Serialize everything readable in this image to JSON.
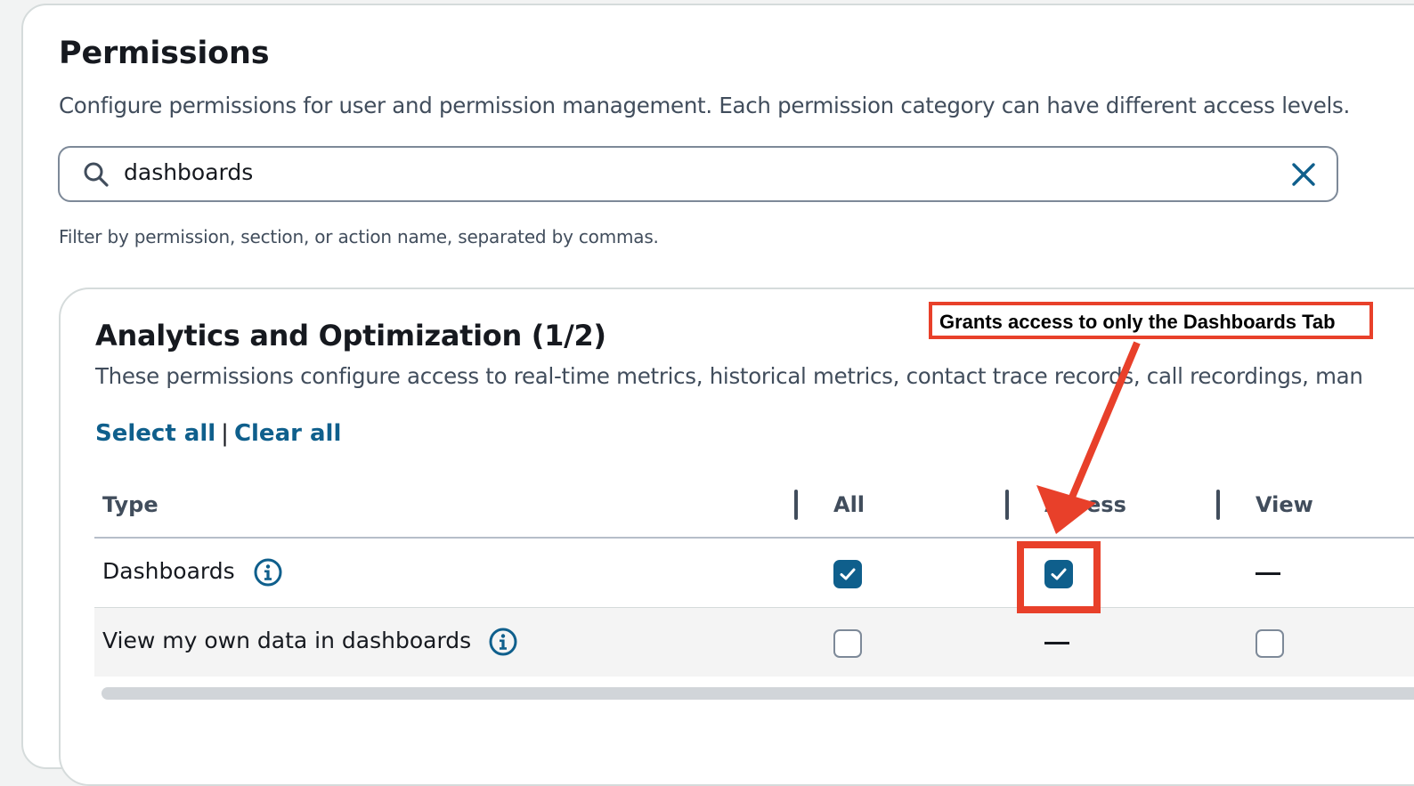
{
  "page": {
    "title": "Permissions",
    "description": "Configure permissions for user and permission management. Each permission category can have different access levels."
  },
  "search": {
    "value": "dashboards",
    "icon": "search-icon",
    "clear_icon": "close-icon",
    "hint": "Filter by permission, section, or action name, separated by commas."
  },
  "section": {
    "title": "Analytics and Optimization (1/2)",
    "description": "These permissions configure access to real-time metrics, historical metrics, contact trace records, call recordings, man",
    "select_all": "Select all",
    "separator": "|",
    "clear_all": "Clear all"
  },
  "table": {
    "columns": [
      "Type",
      "All",
      "Access",
      "View"
    ],
    "rows": [
      {
        "label": "Dashboards",
        "all": "checked",
        "access": "checked",
        "view": "—"
      },
      {
        "label": "View my own data in dashboards",
        "all": "unchecked",
        "access": "—",
        "view": "unchecked"
      }
    ]
  },
  "annotation": {
    "text": "Grants access to only the Dashboards Tab",
    "color": "#e8402a"
  },
  "colors": {
    "accent": "#0f5f8c",
    "annotation_red": "#e8402a"
  }
}
